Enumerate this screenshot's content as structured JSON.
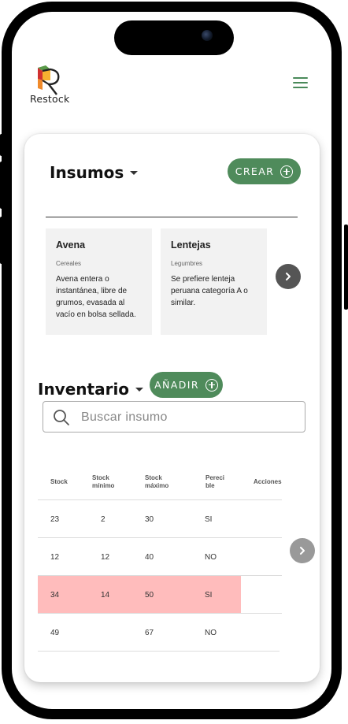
{
  "app": {
    "name": "Restock"
  },
  "insumos": {
    "title": "Insumos",
    "create_label": "CREAR",
    "cards": [
      {
        "name": "Avena",
        "category": "Cereales",
        "description": "Avena entera o instantánea, libre de grumos, evasada al vacío en bolsa sellada."
      },
      {
        "name": "Lentejas",
        "category": "Legumbres",
        "description": "Se prefiere lenteja peruana categoría A o similar."
      }
    ]
  },
  "inventario": {
    "title": "Inventario",
    "add_label": "AÑADIR",
    "search_placeholder": "Buscar insumo",
    "headers": [
      "Stock",
      "Stock\nmínimo",
      "Stock\nmáximo",
      "Pereci\nble",
      "Acciones"
    ],
    "rows": [
      {
        "stock": "23",
        "min": "2",
        "max": "30",
        "perecible": "SI",
        "highlight": false
      },
      {
        "stock": "12",
        "min": "12",
        "max": "40",
        "perecible": "NO",
        "highlight": false
      },
      {
        "stock": "34",
        "min": "14",
        "max": "50",
        "perecible": "SI",
        "highlight": true
      },
      {
        "stock": "49",
        "min": "",
        "max": "67",
        "perecible": "NO",
        "highlight": false
      }
    ]
  },
  "colors": {
    "accent": "#4f8b5b",
    "highlight_row": "#ffbcbc",
    "menu": "#4a8a5a"
  },
  "icons": [
    "logo-r-icon",
    "hamburger-menu-icon",
    "caret-down-icon",
    "plus-circle-icon",
    "chevron-right-icon",
    "search-icon"
  ]
}
